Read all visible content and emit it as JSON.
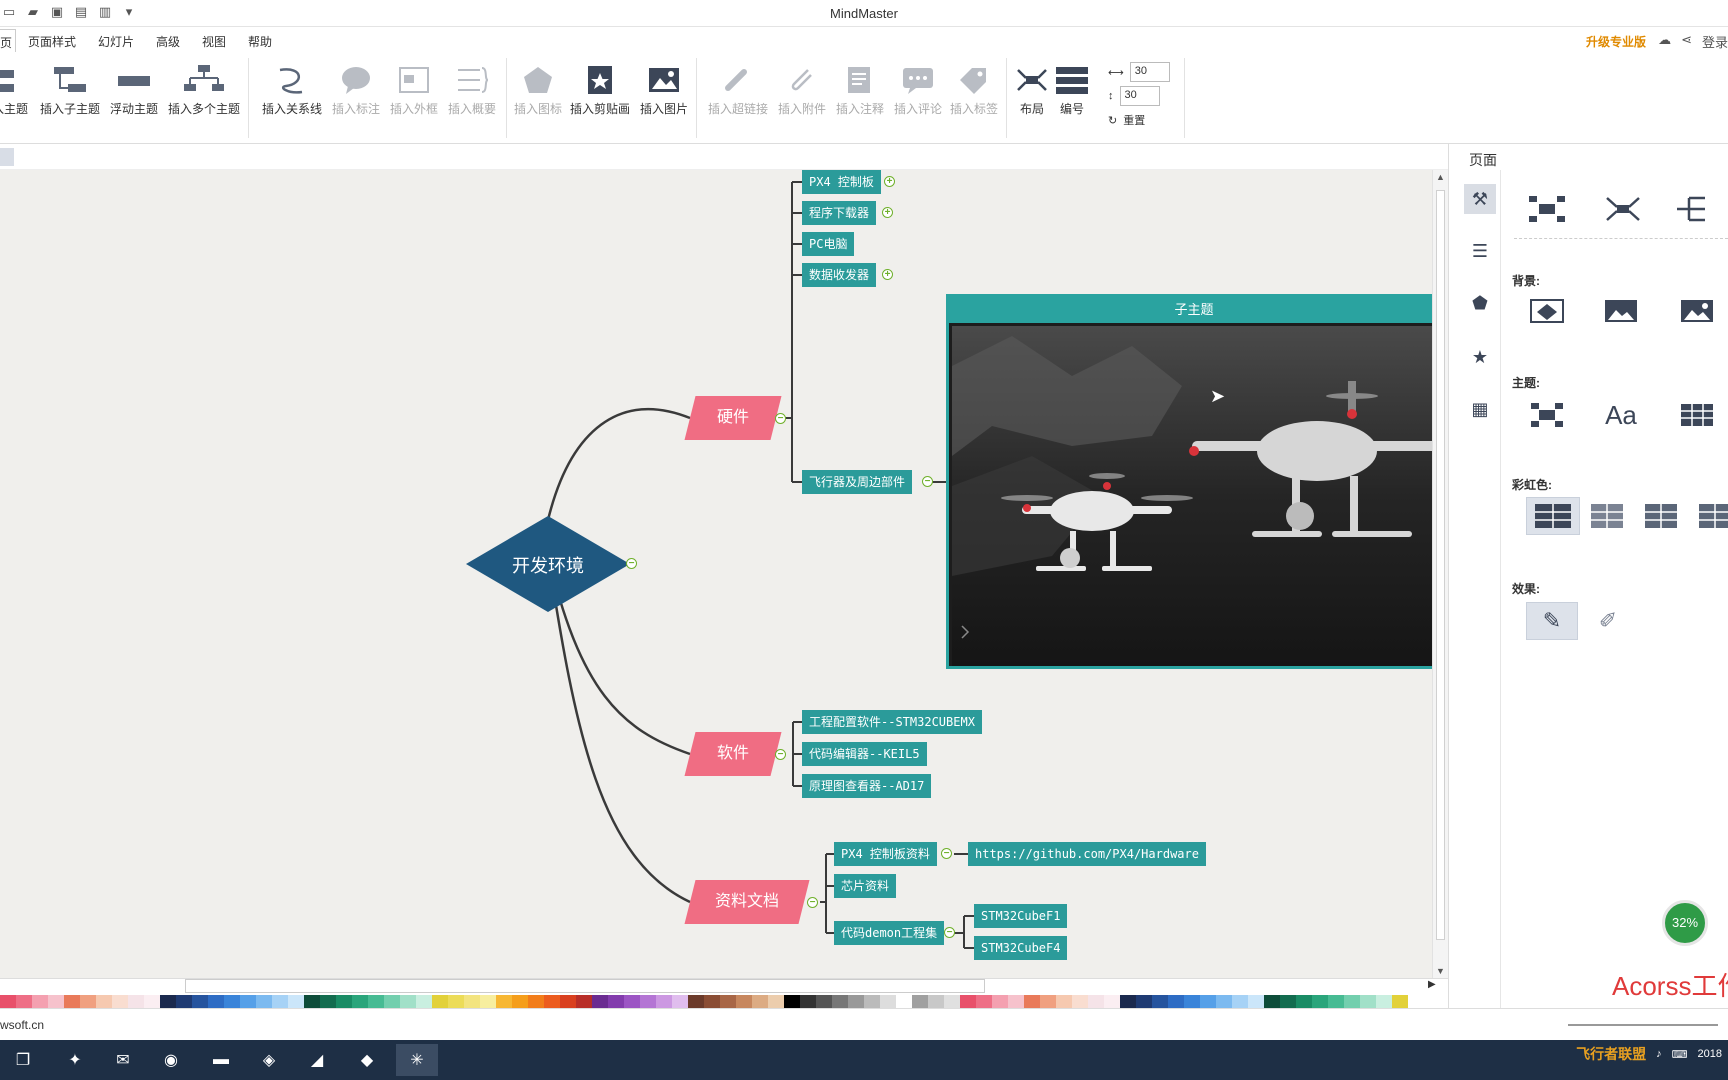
{
  "app": {
    "title": "MindMaster"
  },
  "menu": {
    "items": [
      "页",
      "页面样式",
      "幻灯片",
      "高级",
      "视图",
      "帮助"
    ],
    "upgrade": "升级专业版",
    "login": "登录"
  },
  "ribbon": {
    "insert_topic": "入主题",
    "insert_subtopic": "插入子主题",
    "floating_topic": "浮动主题",
    "insert_multiple": "插入多个主题",
    "insert_relation": "插入关系线",
    "insert_callout": "插入标注",
    "insert_boundary": "插入外框",
    "insert_summary": "插入概要",
    "insert_icon": "插入图标",
    "insert_clipart": "插入剪贴画",
    "insert_image": "插入图片",
    "insert_hyperlink": "插入超链接",
    "insert_attachment": "插入附件",
    "insert_note": "插入注释",
    "insert_comment": "插入评论",
    "insert_tag": "插入标签",
    "layout": "布局",
    "numbering": "编号",
    "spacing_h": "30",
    "spacing_v": "30",
    "reset": "重置"
  },
  "mindmap": {
    "central": "开发环境",
    "branches": {
      "hardware": "硬件",
      "software": "软件",
      "docs": "资料文档"
    },
    "hardware_items": [
      "PX4 控制板",
      "程序下载器",
      "PC电脑",
      "数据收发器",
      "飞行器及周边部件"
    ],
    "software_items": [
      "工程配置软件--STM32CUBEMX",
      "代码编辑器--KEIL5",
      "原理图查看器--AD17"
    ],
    "docs_items": [
      "PX4 控制板资料",
      "芯片资料",
      "代码demon工程集"
    ],
    "docs_link": "https://github.com/PX4/Hardware",
    "demo_items": [
      "STM32CubeF1",
      "STM32CubeF4"
    ],
    "image_title": "子主题"
  },
  "right_panel": {
    "title": "页面",
    "background": "背景:",
    "theme": "主题:",
    "rainbow": "彩虹色:",
    "effect": "效果:"
  },
  "status": {
    "site": "wsoft.cn",
    "cpu_badge": "32%",
    "watermark": "Acorss工作",
    "logo_text": "飞行者联盟",
    "clock_date": "2018"
  },
  "colors": {
    "teal": "#2b9b9a",
    "pink": "#f06d83",
    "central": "#1f5880",
    "upgrade": "#e08a00"
  }
}
